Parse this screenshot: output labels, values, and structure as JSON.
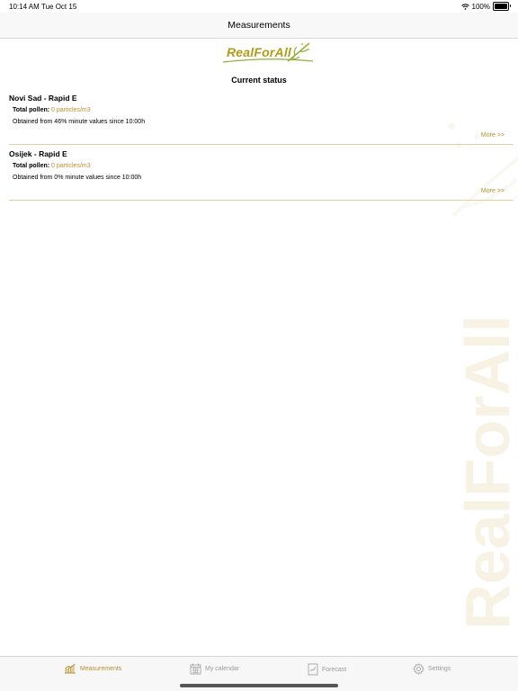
{
  "status_bar": {
    "time": "10:14 AM",
    "date": "Tue Oct 15",
    "battery": "100%",
    "battery_level": 1.0
  },
  "nav": {
    "title": "Measurements"
  },
  "logo": {
    "text": "RealForAll"
  },
  "section_title": "Current status",
  "stations": [
    {
      "name": "Novi Sad - Rapid E",
      "pollen_label": "Total pollen:",
      "pollen_value": "0 particles/m3",
      "obtained": "Obtained from 46% minute values since 10:00h",
      "more": "More >>"
    },
    {
      "name": "Osijek - Rapid E",
      "pollen_label": "Total pollen:",
      "pollen_value": "0 particles/m3",
      "obtained": "Obtained from 0% minute values since 10:00h",
      "more": "More >>"
    }
  ],
  "tabs": [
    {
      "label": "Measurements",
      "icon": "bar-chart-icon",
      "active": true
    },
    {
      "label": "My calendar",
      "icon": "calendar-icon",
      "active": false
    },
    {
      "label": "Forecast",
      "icon": "forecast-icon",
      "active": false
    },
    {
      "label": "Settings",
      "icon": "gear-icon",
      "active": false
    }
  ],
  "colors": {
    "accent": "#b8902f",
    "logo": "#b59a17",
    "inactive": "#9b9b9b",
    "divider": "#e1cfa0"
  }
}
